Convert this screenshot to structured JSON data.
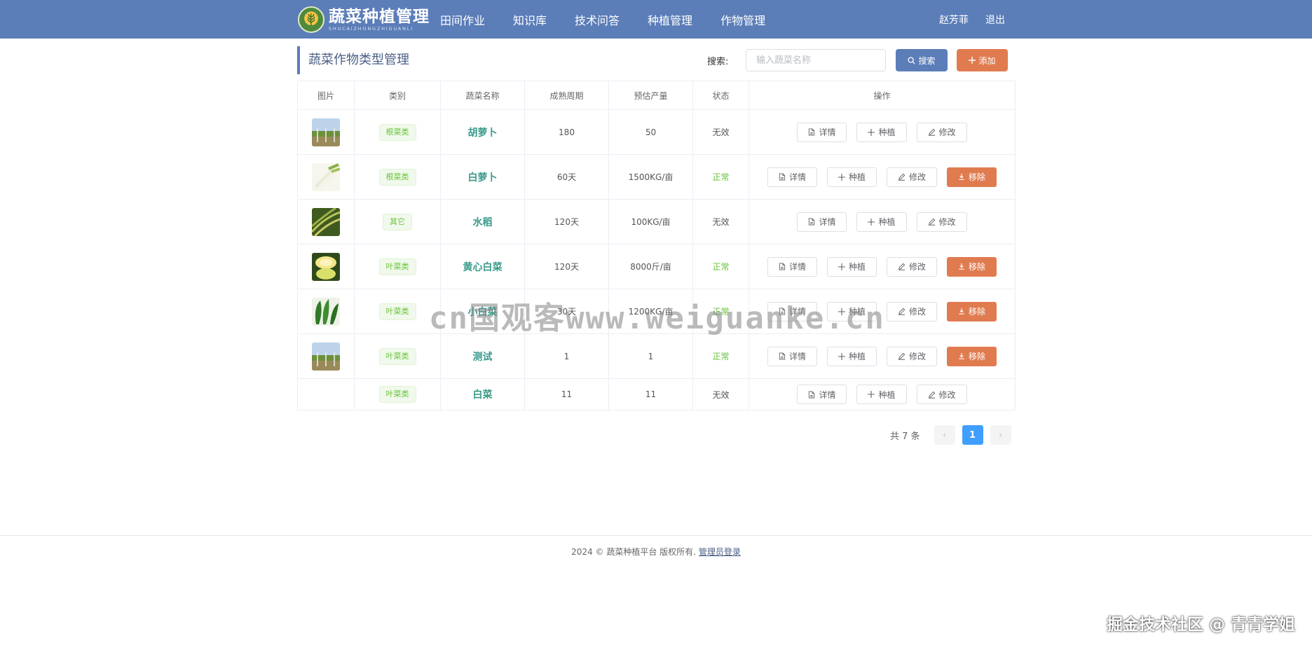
{
  "header": {
    "brand_title": "蔬菜种植管理",
    "brand_subtitle": "SHUCAIZHONGZHIGUANLI",
    "nav": [
      "田间作业",
      "知识库",
      "技术问答",
      "种植管理",
      "作物管理"
    ],
    "user_name": "赵芳菲",
    "logout": "退出"
  },
  "toolbar": {
    "page_title": "蔬菜作物类型管理",
    "search_label": "搜索:",
    "search_placeholder": "输入蔬菜名称",
    "search_button": "搜索",
    "add_button": "添加"
  },
  "table": {
    "columns": [
      "图片",
      "类别",
      "蔬菜名称",
      "成熟周期",
      "预估产量",
      "状态",
      "操作"
    ],
    "actions": {
      "detail": "详情",
      "plant": "种植",
      "edit": "修改",
      "remove": "移除"
    },
    "rows": [
      {
        "image": "field",
        "category": "根菜类",
        "name": "胡萝卜",
        "cycle": "180",
        "yield": "50",
        "status": "无效",
        "status_ok": false
      },
      {
        "image": "leek",
        "category": "根菜类",
        "name": "白萝卜",
        "cycle": "60天",
        "yield": "1500KG/亩",
        "status": "正常",
        "status_ok": true
      },
      {
        "image": "rice",
        "category": "其它",
        "name": "水稻",
        "cycle": "120天",
        "yield": "100KG/亩",
        "status": "无效",
        "status_ok": false
      },
      {
        "image": "cabbage",
        "category": "叶菜类",
        "name": "黄心白菜",
        "cycle": "120天",
        "yield": "8000斤/亩",
        "status": "正常",
        "status_ok": true
      },
      {
        "image": "greens",
        "category": "叶菜类",
        "name": "小白菜",
        "cycle": "30天",
        "yield": "1200KG/亩",
        "status": "正常",
        "status_ok": true
      },
      {
        "image": "field",
        "category": "叶菜类",
        "name": "测试",
        "cycle": "1",
        "yield": "1",
        "status": "正常",
        "status_ok": true
      },
      {
        "image": "",
        "category": "叶菜类",
        "name": "白菜",
        "cycle": "11",
        "yield": "11",
        "status": "无效",
        "status_ok": false
      }
    ]
  },
  "pagination": {
    "total_text": "共 7 条",
    "current_page": "1",
    "prev": "‹",
    "next": "›"
  },
  "footer": {
    "copyright": "2024 © 蔬菜种植平台 版权所有.",
    "admin_link": "管理员登录"
  },
  "watermarks": {
    "center": "cn国观客www.weiguanke.cn",
    "corner": "掘金技术社区 @ 青青学姐"
  },
  "colors": {
    "header": "#5b7db8",
    "accent_orange": "#e07b50",
    "success": "#67c23a",
    "page_active": "#409eff"
  }
}
